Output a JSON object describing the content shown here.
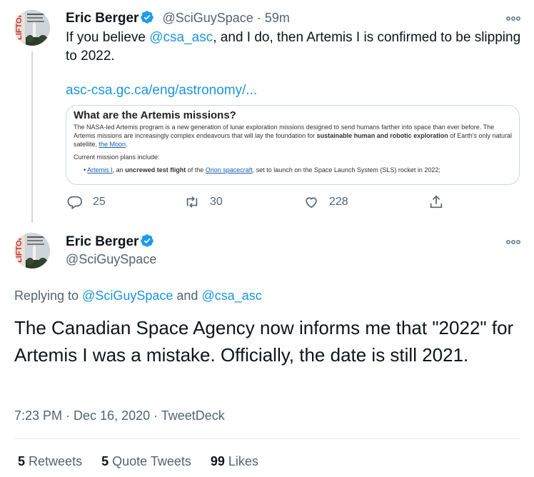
{
  "tweet1": {
    "author_name": "Eric Berger",
    "handle": "@SciGuySpace",
    "separator": "·",
    "time": "59m",
    "text_prefix": "If you believe ",
    "mention": "@csa_asc",
    "text_suffix": ", and I do, then Artemis I is confirmed to be slipping to 2022.",
    "link": "asc-csa.gc.ca/eng/astronomy/...",
    "card": {
      "title": "What are the Artemis missions?",
      "p1_start": "The NASA-led Artemis program is a new generation of lunar exploration missions designed to send humans farther into space than ever before. The Artemis missions are increasingly complex endeavours that will lay the foundation for ",
      "p1_bold": "sustainable human and robotic exploration",
      "p1_end": " of Earth's only natural satellite, ",
      "p1_link": "the Moon",
      "p1_final": ".",
      "p2": "Current mission plans include:",
      "li_link": "Artemis I",
      "li_text1": ", an ",
      "li_bold": "uncrewed test flight",
      "li_text2": " of the ",
      "li_link2": "Orion spacecraft",
      "li_text3": ", set to launch on the Space Launch System (SLS) rocket in 2022;"
    },
    "replies": "25",
    "retweets": "30",
    "likes": "228"
  },
  "tweet2": {
    "author_name": "Eric Berger",
    "handle": "@SciGuySpace",
    "replying_label": "Replying to ",
    "replying_to_1": "@SciGuySpace",
    "replying_and": " and ",
    "replying_to_2": "@csa_asc",
    "text": "The Canadian Space Agency now informs me that \"2022\" for Artemis I was a mistake. Officially, the date is still 2021.",
    "meta": "7:23 PM · Dec 16, 2020 · TweetDeck",
    "stats": {
      "retweets_count": "5",
      "retweets_label": "Retweets",
      "quotes_count": "5",
      "quotes_label": "Quote Tweets",
      "likes_count": "99",
      "likes_label": "Likes"
    }
  },
  "avatar_text": "LIFTOFF",
  "colors": {
    "accent": "#1b95e0",
    "verified": "#1d9bf0",
    "text": "#0f1419",
    "muted": "#536471",
    "border": "#cfd9de"
  }
}
